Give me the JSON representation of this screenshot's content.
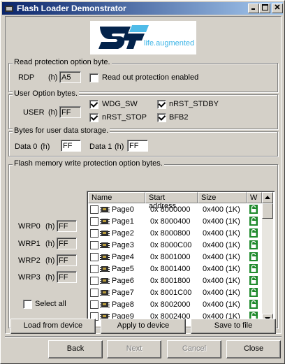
{
  "window": {
    "title": "Flash Loader Demonstrator"
  },
  "logo": {
    "tagline": "life.augmented"
  },
  "rdp": {
    "group_label": "Read protection option byte.",
    "label": "RDP",
    "hex": "(h)",
    "value": "A5",
    "checkbox_label": "Read out protection enabled",
    "checked": false
  },
  "user": {
    "group_label": "User Option bytes.",
    "label": "USER",
    "hex": "(h)",
    "value": "FF",
    "wdg_sw": "WDG_SW",
    "nrst_stdby": "nRST_STDBY",
    "nrst_stop": "nRST_STOP",
    "bfb2": "BFB2"
  },
  "data": {
    "group_label": "Bytes for user data storage.",
    "data0_label": "Data 0",
    "data0_hex": "(h)",
    "data0_value": "FF",
    "data1_label": "Data 1",
    "data1_hex": "(h)",
    "data1_value": "FF"
  },
  "wrp": {
    "group_label": "Flash memory write protection option bytes.",
    "wrp0_label": "WRP0",
    "wrp0_hex": "(h)",
    "wrp0_value": "FF",
    "wrp1_label": "WRP1",
    "wrp1_hex": "(h)",
    "wrp1_value": "FF",
    "wrp2_label": "WRP2",
    "wrp2_hex": "(h)",
    "wrp2_value": "FF",
    "wrp3_label": "WRP3",
    "wrp3_hex": "(h)",
    "wrp3_value": "FF",
    "select_all": "Select all",
    "columns": {
      "name": "Name",
      "start": "Start address",
      "size": "Size",
      "w": "W"
    },
    "pages": [
      {
        "name": "Page0",
        "addr": "0x 8000000",
        "size": "0x400 (1K)"
      },
      {
        "name": "Page1",
        "addr": "0x 8000400",
        "size": "0x400 (1K)"
      },
      {
        "name": "Page2",
        "addr": "0x 8000800",
        "size": "0x400 (1K)"
      },
      {
        "name": "Page3",
        "addr": "0x 8000C00",
        "size": "0x400 (1K)"
      },
      {
        "name": "Page4",
        "addr": "0x 8001000",
        "size": "0x400 (1K)"
      },
      {
        "name": "Page5",
        "addr": "0x 8001400",
        "size": "0x400 (1K)"
      },
      {
        "name": "Page6",
        "addr": "0x 8001800",
        "size": "0x400 (1K)"
      },
      {
        "name": "Page7",
        "addr": "0x 8001C00",
        "size": "0x400 (1K)"
      },
      {
        "name": "Page8",
        "addr": "0x 8002000",
        "size": "0x400 (1K)"
      },
      {
        "name": "Page9",
        "addr": "0x 8002400",
        "size": "0x400 (1K)"
      }
    ]
  },
  "actions": {
    "load": "Load from device",
    "apply": "Apply to device",
    "save": "Save to file"
  },
  "nav": {
    "back": "Back",
    "next": "Next",
    "cancel": "Cancel",
    "close": "Close"
  },
  "colors": {
    "titlebar_start": "#0a246a",
    "titlebar_end": "#a6caf0",
    "lock_green": "#1f8a2c",
    "st_blue": "#03234b"
  }
}
